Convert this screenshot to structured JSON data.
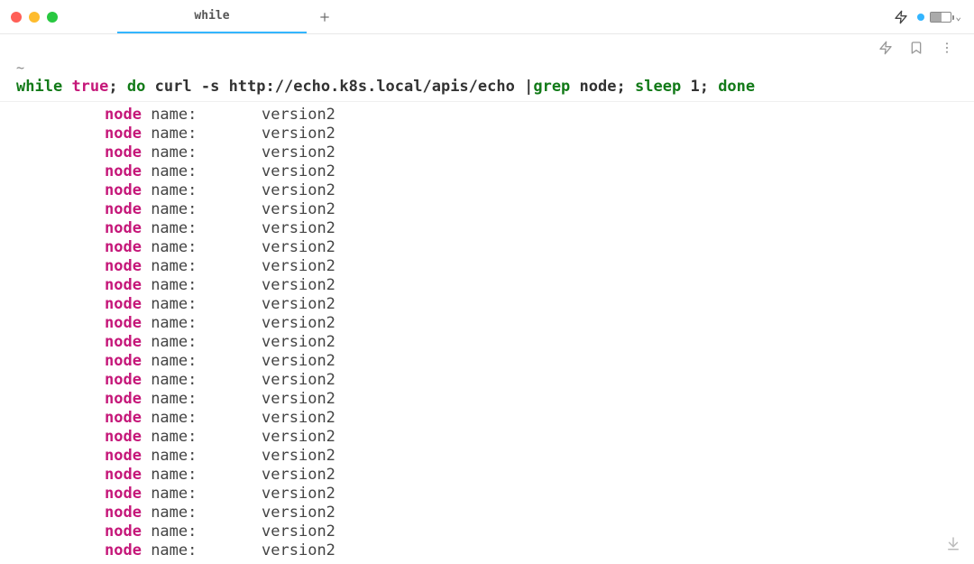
{
  "titlebar": {
    "tab_title": "while"
  },
  "prompt": {
    "marker": "~"
  },
  "command": {
    "while": "while",
    "true": "true",
    "semi1": ";",
    "do": "do",
    "curl": "curl",
    "flag": "-s",
    "url": "http://echo.k8s.local/apis/echo",
    "pipe": "|",
    "grep": "grep",
    "greparg": "node",
    "semi2": ";",
    "sleep": "sleep",
    "sleeparg": "1",
    "semi3": ";",
    "done": "done"
  },
  "output_template": {
    "node": "node",
    "name_label": " name:",
    "spacer": "       ",
    "version": "version2"
  },
  "output_row_count": 24
}
